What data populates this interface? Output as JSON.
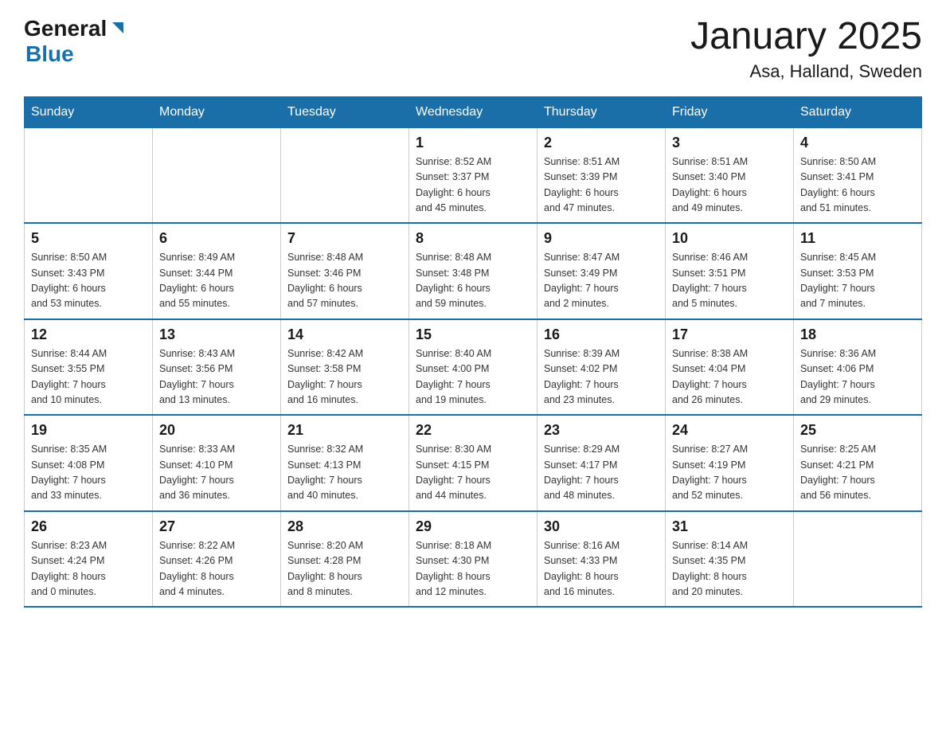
{
  "logo": {
    "general": "General",
    "blue": "Blue"
  },
  "title": "January 2025",
  "location": "Asa, Halland, Sweden",
  "days_of_week": [
    "Sunday",
    "Monday",
    "Tuesday",
    "Wednesday",
    "Thursday",
    "Friday",
    "Saturday"
  ],
  "weeks": [
    [
      {
        "day": "",
        "info": ""
      },
      {
        "day": "",
        "info": ""
      },
      {
        "day": "",
        "info": ""
      },
      {
        "day": "1",
        "info": "Sunrise: 8:52 AM\nSunset: 3:37 PM\nDaylight: 6 hours\nand 45 minutes."
      },
      {
        "day": "2",
        "info": "Sunrise: 8:51 AM\nSunset: 3:39 PM\nDaylight: 6 hours\nand 47 minutes."
      },
      {
        "day": "3",
        "info": "Sunrise: 8:51 AM\nSunset: 3:40 PM\nDaylight: 6 hours\nand 49 minutes."
      },
      {
        "day": "4",
        "info": "Sunrise: 8:50 AM\nSunset: 3:41 PM\nDaylight: 6 hours\nand 51 minutes."
      }
    ],
    [
      {
        "day": "5",
        "info": "Sunrise: 8:50 AM\nSunset: 3:43 PM\nDaylight: 6 hours\nand 53 minutes."
      },
      {
        "day": "6",
        "info": "Sunrise: 8:49 AM\nSunset: 3:44 PM\nDaylight: 6 hours\nand 55 minutes."
      },
      {
        "day": "7",
        "info": "Sunrise: 8:48 AM\nSunset: 3:46 PM\nDaylight: 6 hours\nand 57 minutes."
      },
      {
        "day": "8",
        "info": "Sunrise: 8:48 AM\nSunset: 3:48 PM\nDaylight: 6 hours\nand 59 minutes."
      },
      {
        "day": "9",
        "info": "Sunrise: 8:47 AM\nSunset: 3:49 PM\nDaylight: 7 hours\nand 2 minutes."
      },
      {
        "day": "10",
        "info": "Sunrise: 8:46 AM\nSunset: 3:51 PM\nDaylight: 7 hours\nand 5 minutes."
      },
      {
        "day": "11",
        "info": "Sunrise: 8:45 AM\nSunset: 3:53 PM\nDaylight: 7 hours\nand 7 minutes."
      }
    ],
    [
      {
        "day": "12",
        "info": "Sunrise: 8:44 AM\nSunset: 3:55 PM\nDaylight: 7 hours\nand 10 minutes."
      },
      {
        "day": "13",
        "info": "Sunrise: 8:43 AM\nSunset: 3:56 PM\nDaylight: 7 hours\nand 13 minutes."
      },
      {
        "day": "14",
        "info": "Sunrise: 8:42 AM\nSunset: 3:58 PM\nDaylight: 7 hours\nand 16 minutes."
      },
      {
        "day": "15",
        "info": "Sunrise: 8:40 AM\nSunset: 4:00 PM\nDaylight: 7 hours\nand 19 minutes."
      },
      {
        "day": "16",
        "info": "Sunrise: 8:39 AM\nSunset: 4:02 PM\nDaylight: 7 hours\nand 23 minutes."
      },
      {
        "day": "17",
        "info": "Sunrise: 8:38 AM\nSunset: 4:04 PM\nDaylight: 7 hours\nand 26 minutes."
      },
      {
        "day": "18",
        "info": "Sunrise: 8:36 AM\nSunset: 4:06 PM\nDaylight: 7 hours\nand 29 minutes."
      }
    ],
    [
      {
        "day": "19",
        "info": "Sunrise: 8:35 AM\nSunset: 4:08 PM\nDaylight: 7 hours\nand 33 minutes."
      },
      {
        "day": "20",
        "info": "Sunrise: 8:33 AM\nSunset: 4:10 PM\nDaylight: 7 hours\nand 36 minutes."
      },
      {
        "day": "21",
        "info": "Sunrise: 8:32 AM\nSunset: 4:13 PM\nDaylight: 7 hours\nand 40 minutes."
      },
      {
        "day": "22",
        "info": "Sunrise: 8:30 AM\nSunset: 4:15 PM\nDaylight: 7 hours\nand 44 minutes."
      },
      {
        "day": "23",
        "info": "Sunrise: 8:29 AM\nSunset: 4:17 PM\nDaylight: 7 hours\nand 48 minutes."
      },
      {
        "day": "24",
        "info": "Sunrise: 8:27 AM\nSunset: 4:19 PM\nDaylight: 7 hours\nand 52 minutes."
      },
      {
        "day": "25",
        "info": "Sunrise: 8:25 AM\nSunset: 4:21 PM\nDaylight: 7 hours\nand 56 minutes."
      }
    ],
    [
      {
        "day": "26",
        "info": "Sunrise: 8:23 AM\nSunset: 4:24 PM\nDaylight: 8 hours\nand 0 minutes."
      },
      {
        "day": "27",
        "info": "Sunrise: 8:22 AM\nSunset: 4:26 PM\nDaylight: 8 hours\nand 4 minutes."
      },
      {
        "day": "28",
        "info": "Sunrise: 8:20 AM\nSunset: 4:28 PM\nDaylight: 8 hours\nand 8 minutes."
      },
      {
        "day": "29",
        "info": "Sunrise: 8:18 AM\nSunset: 4:30 PM\nDaylight: 8 hours\nand 12 minutes."
      },
      {
        "day": "30",
        "info": "Sunrise: 8:16 AM\nSunset: 4:33 PM\nDaylight: 8 hours\nand 16 minutes."
      },
      {
        "day": "31",
        "info": "Sunrise: 8:14 AM\nSunset: 4:35 PM\nDaylight: 8 hours\nand 20 minutes."
      },
      {
        "day": "",
        "info": ""
      }
    ]
  ]
}
